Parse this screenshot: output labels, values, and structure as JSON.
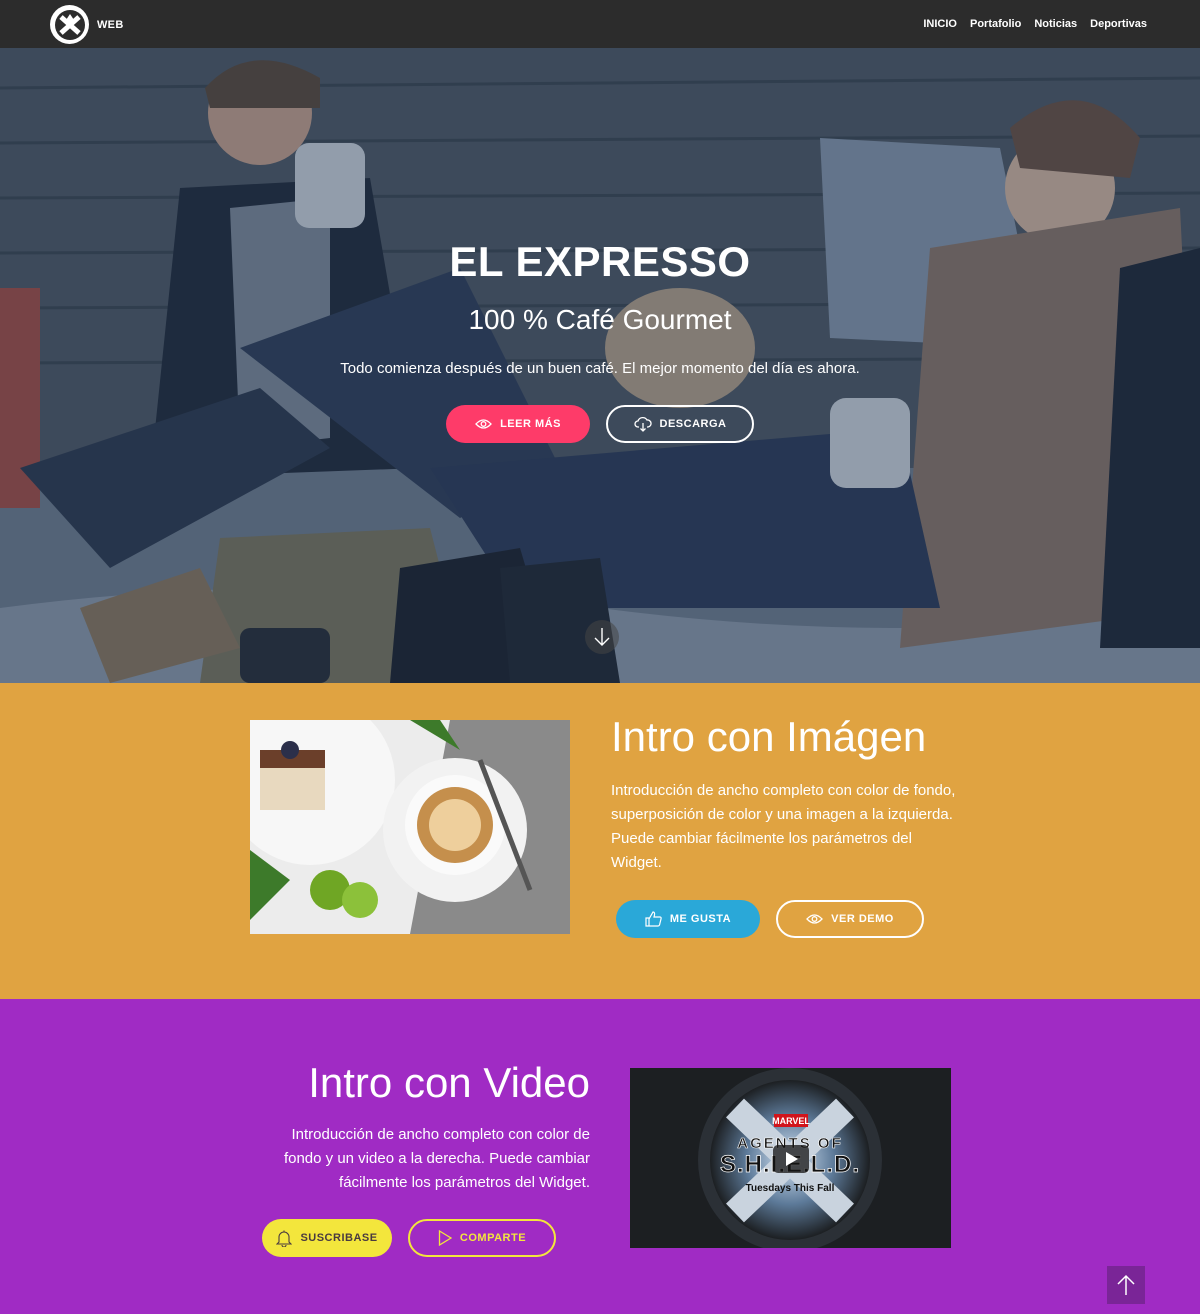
{
  "navbar": {
    "brand": "WEB",
    "links": [
      "INICIO",
      "Portafolio",
      "Noticias",
      "Deportivas"
    ]
  },
  "hero": {
    "title": "EL EXPRESSO",
    "subtitle": "100 % Café Gourmet",
    "text": "Todo comienza después de un buen café. El mejor momento del día es ahora.",
    "btn_read_more": "LEER MÁS",
    "btn_download": "DESCARGA"
  },
  "intro_image": {
    "title": "Intro con Imágen",
    "text": "Introducción de ancho completo con color de fondo, superposición de color y una imagen a la izquierda. Puede cambiar fácilmente los parámetros del Widget.",
    "btn_like": "ME GUSTA",
    "btn_demo": "VER DEMO"
  },
  "intro_video": {
    "title": "Intro con Video",
    "text": "Introducción de ancho completo con color de fondo y un video a la derecha. Puede cambiar fácilmente los parámetros del Widget.",
    "btn_subscribe": "SUSCRIBASE",
    "btn_share": "COMPARTE",
    "video_brand": "MARVEL",
    "video_title_1": "AGENTS OF",
    "video_title_2": "S.H.I.E.L.D.",
    "video_tagline": "Tuesdays This Fall"
  },
  "colors": {
    "navbar": "#2c2c2c",
    "pink": "#fe3b69",
    "orange": "#e0a341",
    "blue": "#2aa8d8",
    "purple": "#a02bc4",
    "yellow": "#f3e63c"
  },
  "icons": {
    "logo": "shield-logo-icon",
    "read_more": "eye-icon",
    "download": "cloud-download-icon",
    "scroll": "arrow-down-icon",
    "like": "thumbs-up-icon",
    "demo": "eye-icon",
    "subscribe": "bell-icon",
    "share": "play-outline-icon",
    "video_play": "play-icon",
    "back_top": "arrow-up-icon"
  }
}
